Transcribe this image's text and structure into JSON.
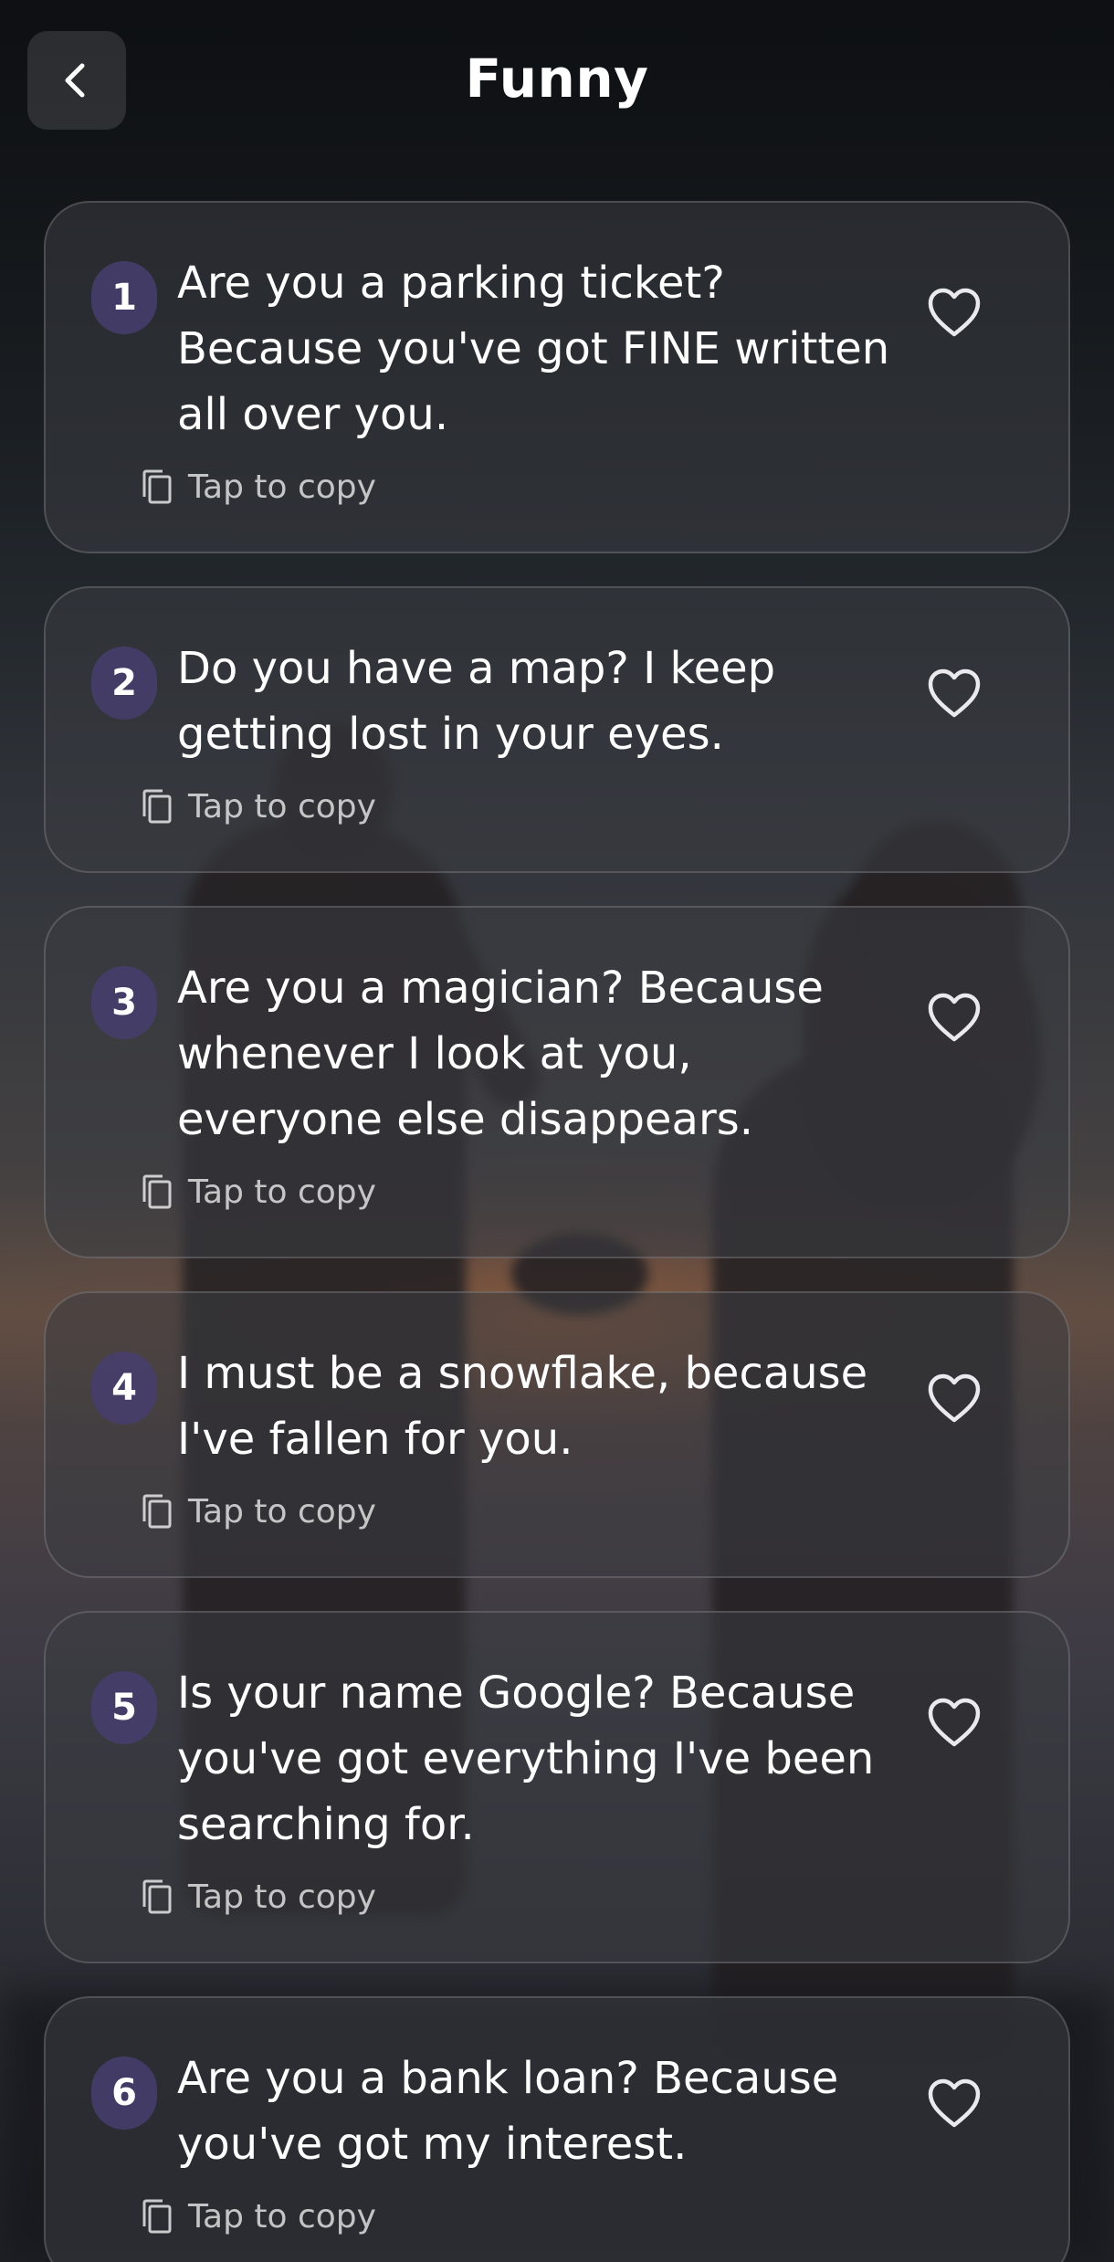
{
  "header": {
    "title": "Funny",
    "back_icon": "chevron-left-icon"
  },
  "lines": [
    {
      "number": "1",
      "text": "Are you a parking ticket? Because you've got FINE written all over you.",
      "copy_label": "Tap to copy"
    },
    {
      "number": "2",
      "text": "Do you have a map? I keep getting lost in your eyes.",
      "copy_label": "Tap to copy"
    },
    {
      "number": "3",
      "text": "Are you a magician? Because whenever I look at you, everyone else disappears.",
      "copy_label": "Tap to copy"
    },
    {
      "number": "4",
      "text": "I must be a snowflake, because I've fallen for you.",
      "copy_label": "Tap to copy"
    },
    {
      "number": "5",
      "text": "Is your name Google? Because you've got everything I've been searching for.",
      "copy_label": "Tap to copy"
    },
    {
      "number": "6",
      "text": "Are you a bank loan? Because you've got my interest.",
      "copy_label": "Tap to copy"
    }
  ],
  "icons": {
    "favorite": "heart-outline-icon",
    "copy": "copy-icon"
  },
  "colors": {
    "badge": "#463e6e",
    "card": "#3a3c42"
  }
}
